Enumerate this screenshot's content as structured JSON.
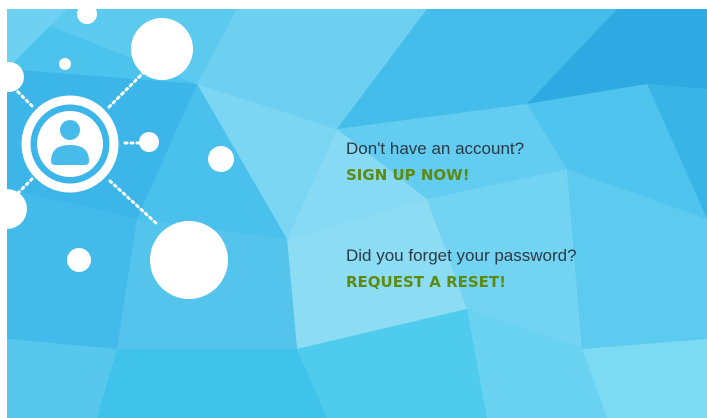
{
  "signup": {
    "prompt": "Don't have an account?",
    "link_label": "SIGN UP NOW!"
  },
  "reset": {
    "prompt": "Did you forget your password?",
    "link_label": "REQUEST A RESET!"
  },
  "colors": {
    "background_primary": "#4cc3ec",
    "background_light": "#7fd8f2",
    "background_dark": "#31ace2",
    "prompt_text": "#2b3a45",
    "link_text": "#5f8a12",
    "network_nodes": "#ffffff"
  },
  "icons": {
    "user_avatar": "user-avatar-icon",
    "network": "network-graphic"
  }
}
